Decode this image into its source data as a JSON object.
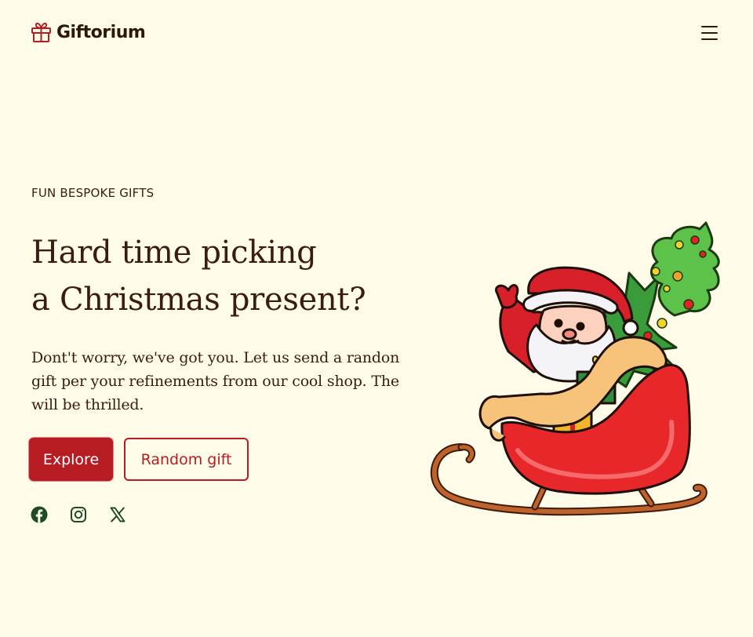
{
  "header": {
    "brand": "Giftorium",
    "menu_icon": "hamburger-menu-icon"
  },
  "hero": {
    "eyebrow": "FUN BESPOKE GIFTS",
    "headline_line1": "Hard time picking",
    "headline_line2": "a Christmas present?",
    "intro": "Dont't worry, we've got you. Let us send a randon gift per your refinements from our cool shop. The will be thrilled.",
    "primary_button": "Explore",
    "secondary_button": "Random gift",
    "illustration": "santa-sleigh-illustration"
  },
  "social": {
    "icons": [
      "facebook-icon",
      "instagram-icon",
      "x-icon"
    ]
  },
  "colors": {
    "background": "#fefbe9",
    "text": "#3b1d0e",
    "accent": "#b71c23",
    "social": "#1f4a2c"
  }
}
